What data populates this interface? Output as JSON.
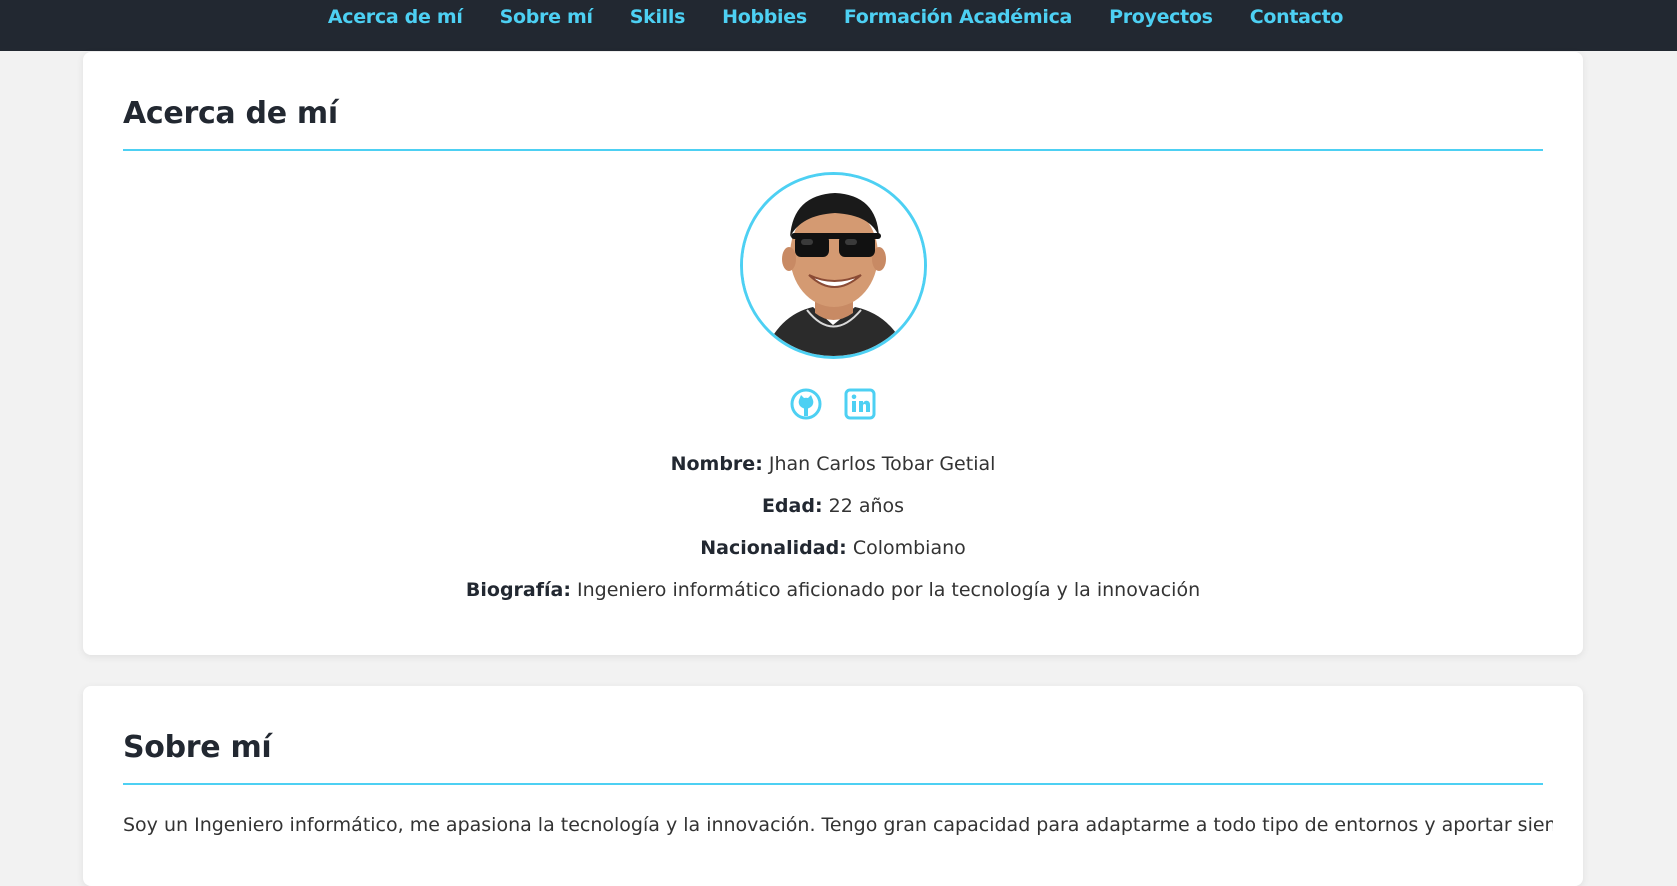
{
  "nav": {
    "links": [
      "Acerca de mí",
      "Sobre mí",
      "Skills",
      "Hobbies",
      "Formación Académica",
      "Proyectos",
      "Contacto"
    ]
  },
  "about": {
    "title": "Acerca de mí",
    "socials": [
      {
        "name": "github-icon"
      },
      {
        "name": "linkedin-icon"
      }
    ],
    "info": [
      {
        "label": "Nombre:",
        "value": "Jhan Carlos Tobar Getial"
      },
      {
        "label": "Edad:",
        "value": "22 años"
      },
      {
        "label": "Nacionalidad:",
        "value": "Colombiano"
      },
      {
        "label": "Biografía:",
        "value": "Ingeniero informático aficionado por la tecnología y la innovación"
      }
    ]
  },
  "sobre": {
    "title": "Sobre mí",
    "text": "Soy un Ingeniero informático, me apasiona la tecnología y la innovación. Tengo gran capacidad para adaptarme a todo tipo de entornos y aportar siempre lo"
  },
  "colors": {
    "accent": "#4dd0f3",
    "navbar": "#222831",
    "background": "#f2f2f2"
  }
}
